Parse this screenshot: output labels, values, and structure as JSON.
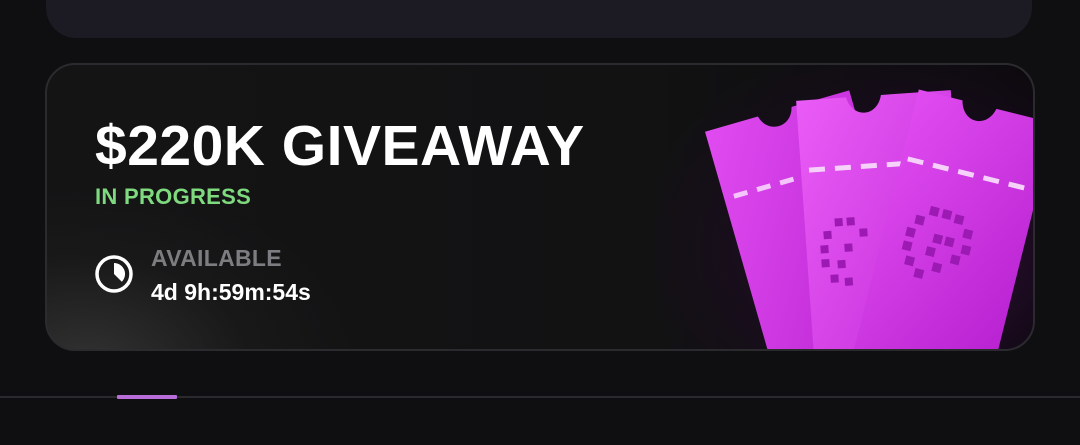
{
  "giveaway": {
    "title": "$220K GIVEAWAY",
    "status": "IN PROGRESS",
    "availability_label": "AVAILABLE",
    "countdown": "4d 9h:59m:54s",
    "art": "pink-tickets",
    "clock_icon": "clock-icon"
  },
  "colors": {
    "status": "#7fd97f",
    "tab_indicator": "#b86cd8",
    "ticket": "#d431e6"
  },
  "tabs": {
    "active_index": 0
  }
}
